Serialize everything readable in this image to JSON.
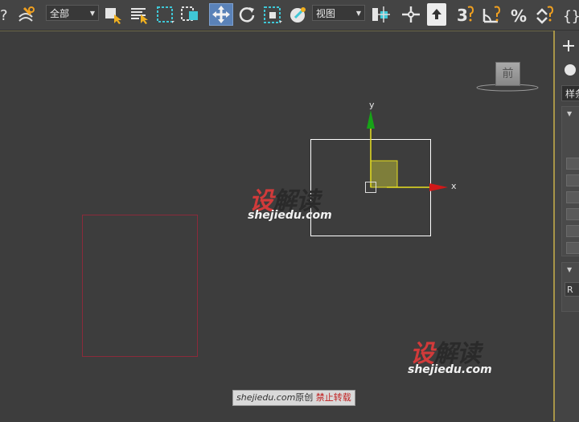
{
  "toolbar": {
    "selection_filter": "全部",
    "reference_coord": "视图",
    "snap_label": "3",
    "icons": [
      "help-icon",
      "bind-space-warp-icon",
      "select-object-icon",
      "select-by-name-icon",
      "rect-selection-region-icon",
      "window-crossing-icon",
      "select-move-icon",
      "select-rotate-icon",
      "select-scale-icon",
      "select-place-icon",
      "use-pivot-center-icon",
      "select-manipulate-icon",
      "snaps-toggle-icon",
      "angle-snap-icon",
      "percent-snap-icon",
      "spinner-snap-icon",
      "named-selection-icon"
    ]
  },
  "viewport": {
    "viewcube_face": "前",
    "gizmo_y_label": "y",
    "gizmo_x_label": "x",
    "colors": {
      "selected_box": "#ffffff",
      "unselected_box": "#8b2a3a",
      "gizmo_y": "#17a317",
      "gizmo_x": "#d01818",
      "gizmo_plane": "#8a8a3a",
      "gizmo_yellow": "#e8e020"
    }
  },
  "watermarks": [
    {
      "logo_red": "设",
      "logo_dark": "解读",
      "url": "shejiedu.com"
    },
    {
      "logo_red": "设",
      "logo_dark": "解读",
      "url": "shejiedu.com"
    }
  ],
  "caption": {
    "url": "shejiedu.com",
    "original": "原创",
    "warning": "禁止转载"
  },
  "command_panel": {
    "tab_label": "样条",
    "section_collapse": "▼",
    "field_label": "R"
  }
}
